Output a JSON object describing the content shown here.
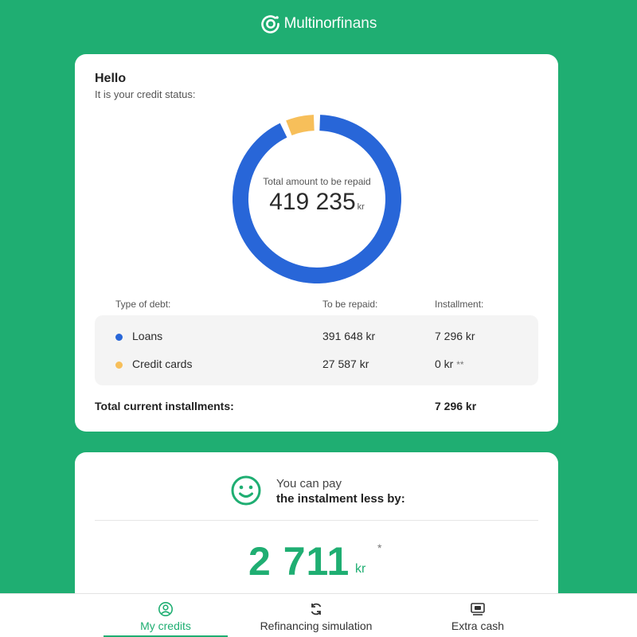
{
  "brand": {
    "name_strong": "Multinor",
    "name_light": "finans"
  },
  "status_card": {
    "greeting": "Hello",
    "subtitle": "It is your credit status:",
    "donut": {
      "label": "Total amount to be repaid",
      "amount": "419 235",
      "unit": "kr",
      "segments": [
        {
          "name": "Loans",
          "value": 391648,
          "color": "#2866d8"
        },
        {
          "name": "Credit cards",
          "value": 27587,
          "color": "#f7bf5a"
        }
      ]
    },
    "columns": {
      "type": "Type of debt:",
      "repay": "To be repaid:",
      "installment": "Installment:"
    },
    "rows": [
      {
        "name": "Loans",
        "repay": "391 648 kr",
        "installment": "7 296 kr",
        "note": "",
        "color": "#2866d8"
      },
      {
        "name": "Credit cards",
        "repay": "27 587 kr",
        "installment": "0 kr",
        "note": "**",
        "color": "#f7bf5a"
      }
    ],
    "total_label": "Total current installments:",
    "total_value": "7 296 kr"
  },
  "savings_card": {
    "line1": "You can pay",
    "line2": "the instalment less by:",
    "amount": "2 711",
    "unit": "kr",
    "star": "*"
  },
  "nav": {
    "items": [
      {
        "label": "My credits",
        "icon": "user-circle-icon",
        "active": true
      },
      {
        "label": "Refinancing simulation",
        "icon": "refresh-icon",
        "active": false
      },
      {
        "label": "Extra cash",
        "icon": "cash-icon",
        "active": false
      }
    ]
  },
  "colors": {
    "accent": "#1fae72",
    "loan": "#2866d8",
    "card": "#f7bf5a"
  }
}
